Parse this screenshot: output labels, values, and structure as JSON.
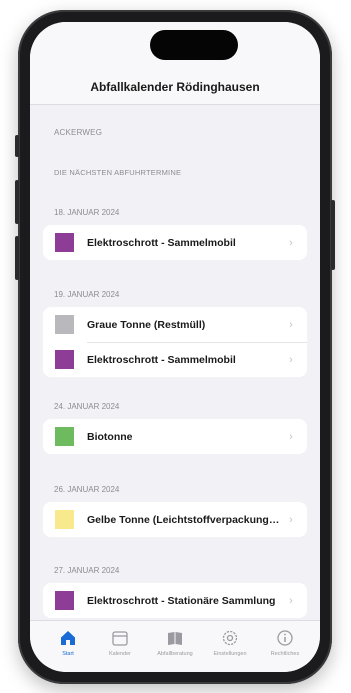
{
  "app": {
    "title": "Abfallkalender Rödinghausen",
    "street": "ACKERWEG",
    "upcoming_label": "DIE NÄCHSTEN ABFUHRTERMINE"
  },
  "groups": [
    {
      "date": "18. JANUAR 2024",
      "items": [
        {
          "label": "Elektroschrott - Sammelmobil",
          "color": "#8e3d96"
        }
      ]
    },
    {
      "date": "19. JANUAR 2024",
      "items": [
        {
          "label": "Graue Tonne (Restmüll)",
          "color": "#b9b9bd"
        },
        {
          "label": "Elektroschrott - Sammelmobil",
          "color": "#8e3d96"
        }
      ]
    },
    {
      "date": "24. JANUAR 2024",
      "items": [
        {
          "label": "Biotonne",
          "color": "#6dbb5e"
        }
      ]
    },
    {
      "date": "26. JANUAR 2024",
      "items": [
        {
          "label": "Gelbe Tonne (Leichtstoffverpackungen)",
          "color": "#f8ea8c"
        }
      ]
    },
    {
      "date": "27. JANUAR 2024",
      "items": [
        {
          "label": "Elektroschrott - Stationäre Sammlung",
          "color": "#8e3d96"
        }
      ]
    }
  ],
  "chevron_glyph": "›",
  "tabs": [
    {
      "label": "Start",
      "icon": "home-icon"
    },
    {
      "label": "Kalender",
      "icon": "calendar-icon"
    },
    {
      "label": "Abfallberatung",
      "icon": "book-icon"
    },
    {
      "label": "Einstellungen",
      "icon": "gear-icon"
    },
    {
      "label": "Rechtliches",
      "icon": "info-icon"
    }
  ],
  "colors": {
    "accent": "#1a6bd6",
    "inactive_tab": "#9a9aa0"
  }
}
